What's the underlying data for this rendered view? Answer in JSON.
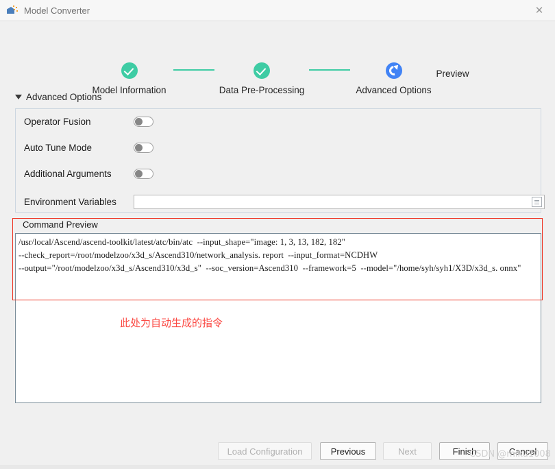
{
  "window": {
    "title": "Model Converter",
    "app_icon": "cube-icon",
    "close_icon": "close-icon"
  },
  "stepper": {
    "steps": [
      {
        "label": "Model Information",
        "state": "done",
        "icon": "check-circle-icon"
      },
      {
        "label": "Data Pre-Processing",
        "state": "done",
        "icon": "check-circle-icon"
      },
      {
        "label": "Advanced Options",
        "state": "current",
        "icon": "spinner-circle-icon"
      },
      {
        "label": "Preview",
        "state": "pending",
        "icon": ""
      }
    ],
    "done_color": "#3ecca4",
    "current_color": "#4183f5"
  },
  "section": {
    "title": "Advanced Options",
    "caret_icon": "caret-down-icon",
    "expanded": true
  },
  "options": [
    {
      "label": "Operator Fusion",
      "type": "toggle",
      "value": "off"
    },
    {
      "label": "Auto Tune Mode",
      "type": "toggle",
      "value": "off"
    },
    {
      "label": "Additional Arguments",
      "type": "toggle",
      "value": "off"
    }
  ],
  "env_variables": {
    "label": "Environment Variables",
    "value": "",
    "placeholder": "",
    "button_icon": "list-document-icon"
  },
  "command_preview": {
    "label": "Command Preview",
    "lines": [
      "/usr/local/Ascend/ascend-toolkit/latest/atc/bin/atc  --input_shape=\"image: 1, 3, 13, 182, 182\"",
      "--check_report=/root/modelzoo/x3d_s/Ascend310/network_analysis. report  --input_format=NCDHW",
      "--output=\"/root/modelzoo/x3d_s/Ascend310/x3d_s\"  --soc_version=Ascend310  --framework=5  --model=\"/home/syh/syh1/X3D/x3d_s. onnx\""
    ],
    "annotation": "此处为自动生成的指令",
    "annotation_color": "#fb4a44",
    "highlight_border_color": "#ee3322"
  },
  "footer": {
    "buttons": [
      {
        "label": "Load Configuration",
        "state": "disabled"
      },
      {
        "label": "Previous",
        "state": "enabled"
      },
      {
        "label": "Next",
        "state": "disabled"
      },
      {
        "label": "Finish",
        "state": "enabled"
      },
      {
        "label": "Cancel",
        "state": "enabled"
      }
    ]
  },
  "watermark": {
    "text": "CSDN @miku1008"
  }
}
